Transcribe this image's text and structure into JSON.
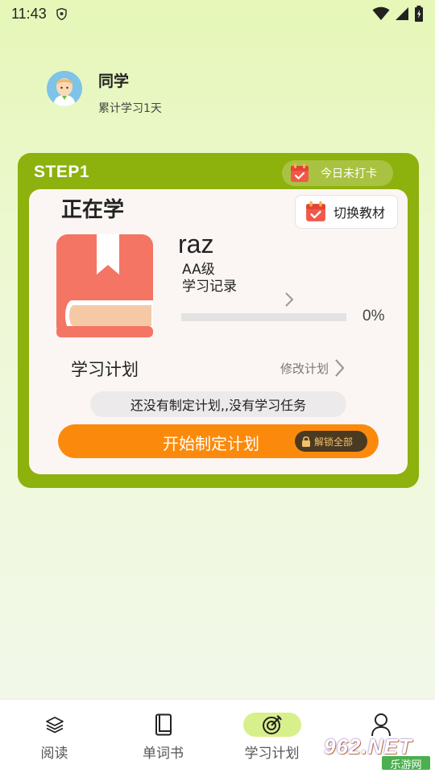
{
  "status_bar": {
    "time": "11:43"
  },
  "profile": {
    "name": "同学",
    "subtitle": "累计学习1天"
  },
  "step": {
    "label": "STEP1",
    "checkin_text": "今日未打卡",
    "section_title": "正在学",
    "switch_button": "切换教材",
    "book": {
      "title": "raz",
      "level": "AA级",
      "record_link": "学习记录",
      "progress_text": "0%",
      "progress_value": 0
    },
    "plan_label": "学习计划",
    "modify_plan": "修改计划",
    "plan_note": "还没有制定计划,,没有学习任务",
    "start_button": "开始制定计划",
    "unlock_label": "解锁全部"
  },
  "nav": {
    "items": [
      {
        "label": "阅读",
        "icon": "layers-icon"
      },
      {
        "label": "单词书",
        "icon": "book-icon"
      },
      {
        "label": "学习计划",
        "icon": "target-icon"
      },
      {
        "label": "",
        "icon": "person-icon"
      }
    ],
    "active_index": 2
  },
  "watermark": {
    "text": "962.NET",
    "sub": "乐游网"
  },
  "colors": {
    "accent_green": "#8db10d",
    "orange": "#fb8a0c",
    "book_red": "#f47563"
  }
}
